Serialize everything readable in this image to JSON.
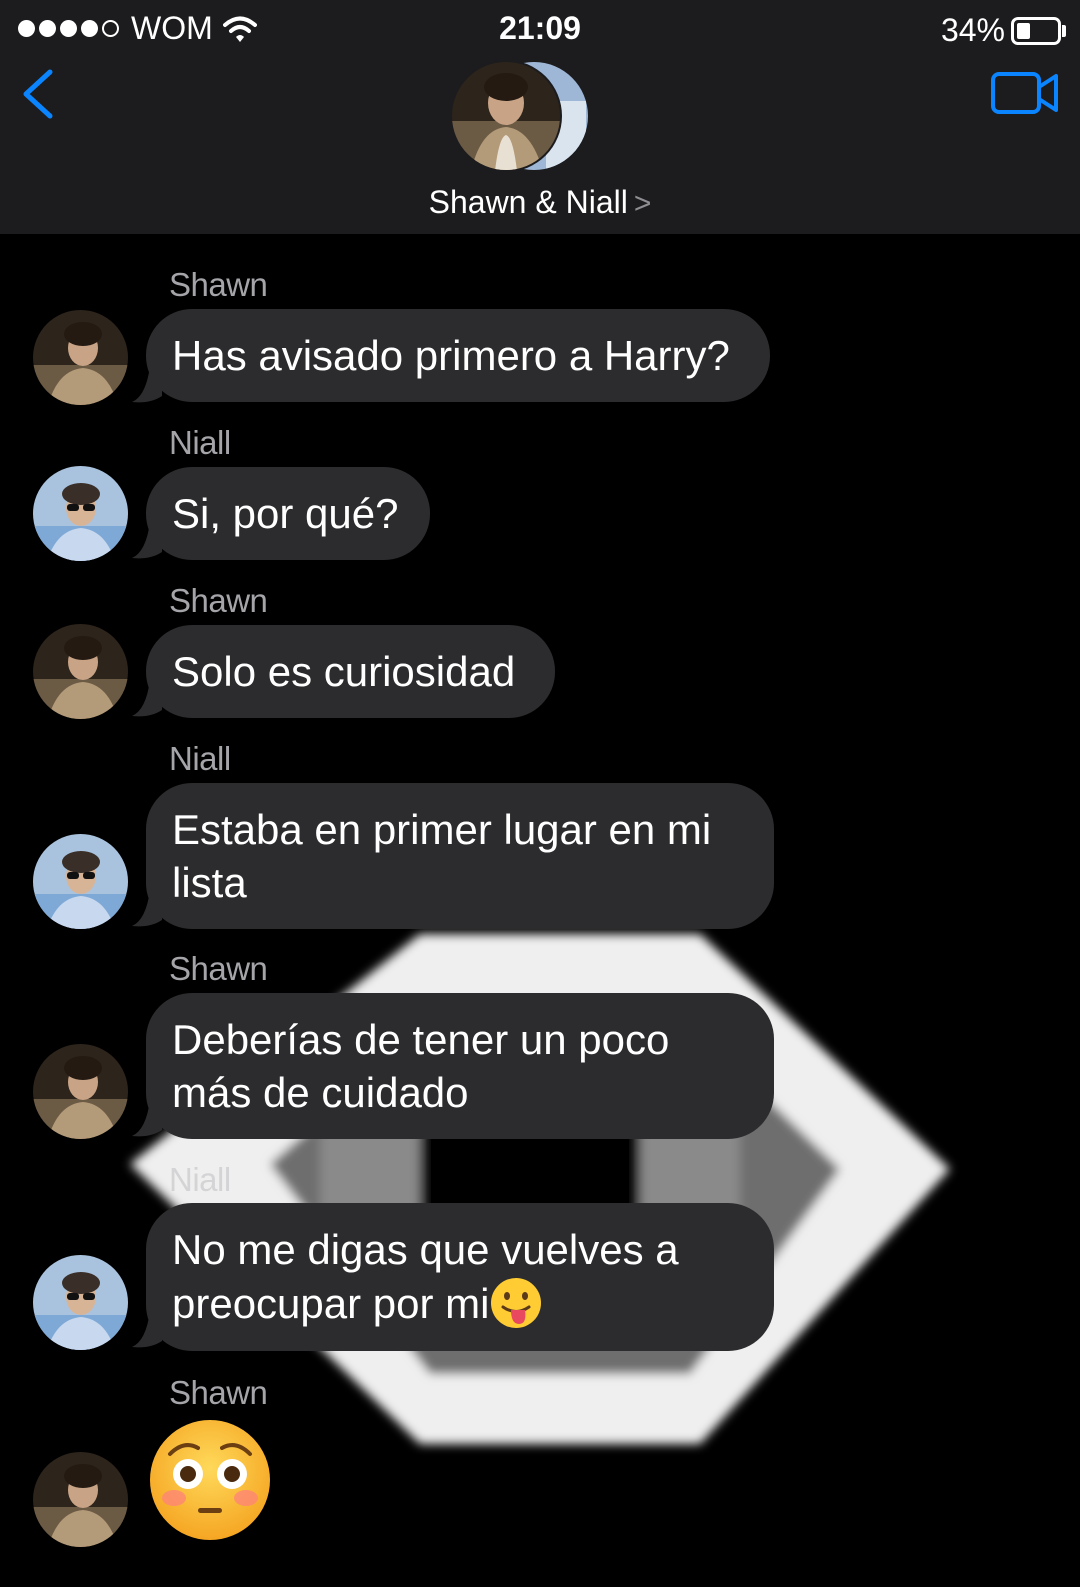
{
  "status_bar": {
    "carrier": "WOM",
    "time": "21:09",
    "battery_percent_text": "34%",
    "battery_level": 0.34
  },
  "header": {
    "title": "Shawn & Niall",
    "chevron": ">",
    "back_icon": "chevron-left-icon",
    "video_icon": "video-camera-icon"
  },
  "colors": {
    "accent": "#0a84ff",
    "bubble": "#2c2c2e",
    "header_bg": "#1c1c1e",
    "sender_name": "#a4a4a9"
  },
  "messages": [
    {
      "sender": "Shawn",
      "text": "Has avisado primero a Harry?"
    },
    {
      "sender": "Niall",
      "text": "Si, por qué?"
    },
    {
      "sender": "Shawn",
      "text": "Solo es curiosidad"
    },
    {
      "sender": "Niall",
      "text": "Estaba en primer lugar en mi lista"
    },
    {
      "sender": "Shawn",
      "text": "Deberías de tener un poco más de cuidado"
    },
    {
      "sender": "Niall",
      "text": "No me digas que vuelves a preocupar por mi",
      "emoji": "face-with-tongue-icon"
    },
    {
      "sender": "Shawn",
      "emoji": "flushed-face-icon"
    }
  ]
}
